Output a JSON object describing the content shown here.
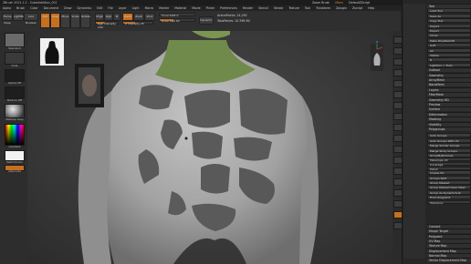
{
  "titlebar": {
    "title": "ZBrush 2021.1.2 - SubstAddition_001",
    "menu_label": "Menu",
    "default_zscript": "DefaultZScript",
    "left_hint": "Zoom Brush",
    "progress_label": "2"
  },
  "menubar": {
    "items": [
      "Alpha",
      "Brush",
      "Color",
      "Document",
      "Draw",
      "Dynamics",
      "Edit",
      "File",
      "Layer",
      "Light",
      "Macro",
      "Marker",
      "Material",
      "Movie",
      "Picker",
      "Preferences",
      "Render",
      "Stencil",
      "Stroke",
      "Texture",
      "Tool",
      "Transform",
      "Zplugin",
      "Zscript",
      "Help"
    ]
  },
  "toolbar": {
    "home_label": "Home Page",
    "lightbox_label": "LightBox",
    "live_boolean_label": "Live Boolean",
    "edit_label": "Edit",
    "draw_label": "Draw",
    "move_label": "Move",
    "scale_label": "Scale",
    "rotate_label": "Rotate",
    "mrgb_label": "Mrgb",
    "rgb_label": "Rgb",
    "m_label": "M",
    "zadd_label": "Zadd",
    "zsub_label": "Zsub",
    "zcut_label": "Zcut",
    "focal_shift_label": "Focal Shift 0",
    "draw_size_label": "Draw Size 64",
    "z_intensity_label": "Z Intensity 25",
    "rgb_intensity_label": "Rgb Intensity 100",
    "dynamic_label": "Dynamic",
    "active_points_label": "ActivePoints: 24,292",
    "total_points_label": "TotalPoints: 10.398 Mil"
  },
  "left_shelf": {
    "brush_label": "Standard",
    "stroke_label": "Dots",
    "alpha_label": "Alpha Off",
    "texture_label": "Texture Off",
    "material_label": "MatCap Gray",
    "gradient_label": "Gradient",
    "switch_color_label": "SwitchColor",
    "alternate_label": "Alternate"
  },
  "right_panel": {
    "items": [
      {
        "label": "Tool",
        "type": "hdr"
      },
      {
        "label": "Load Tool",
        "type": "btn"
      },
      {
        "label": "Save As",
        "type": "btn"
      },
      {
        "label": "Copy Tool",
        "type": "btn"
      },
      {
        "label": "Import",
        "type": "btn"
      },
      {
        "label": "Export",
        "type": "btn"
      },
      {
        "label": "Clone",
        "type": "btn"
      },
      {
        "label": "Make PolyMesh3D",
        "type": "btn"
      },
      {
        "label": "GoZ",
        "type": "btn"
      },
      {
        "label": "All",
        "type": "btn"
      },
      {
        "label": "Visible",
        "type": "btn"
      },
      {
        "label": "R",
        "type": "btn"
      },
      {
        "label": "Lightbox > Tools",
        "type": "btn"
      },
      {
        "label": "Subtool",
        "type": "hdr"
      },
      {
        "label": "Geometry",
        "type": "hdr"
      },
      {
        "label": "ArrayMesh",
        "type": "hdr"
      },
      {
        "label": "NanoMesh",
        "type": "hdr"
      },
      {
        "label": "Layers",
        "type": "hdr"
      },
      {
        "label": "FiberMesh",
        "type": "hdr"
      },
      {
        "label": "Geometry HD",
        "type": "hdr"
      },
      {
        "label": "Preview",
        "type": "hdr"
      },
      {
        "label": "Surface",
        "type": "hdr"
      },
      {
        "label": "Deformation",
        "type": "hdr"
      },
      {
        "label": "Masking",
        "type": "hdr"
      },
      {
        "label": "Visibility",
        "type": "hdr"
      },
      {
        "label": "Polygroups",
        "type": "hdr"
      }
    ],
    "auto_groups_label": "Auto Groups",
    "uv_groups_label": "UV Groups",
    "auto_groups_with_uv_label": "Auto Groups With UV",
    "merge_similar_label": "Merge Similar Groups",
    "merge_stray_label": "Merge Stray Groups",
    "group_by_normals_label": "GroupByNormals",
    "max_angle_label": "MaxAngle 20",
    "groups_by_normals_label": "Group As Dynamesh",
    "coverage_label": "Coverage",
    "polish_label": "Polish",
    "crease_pg_label": "Crease PG",
    "groups_split_label": "Groups Split",
    "group_masked_label": "Group Masked",
    "group_masked_clear_label": "Group Masked Clear Mask",
    "group_as_dyna_label": "Group As DynamicSub",
    "from_polypaint_label": "From Polypaint",
    "tolerance_label": "Tolerance",
    "contact_label": "Contact",
    "morph_target_label": "Morph Target",
    "polypaint_label": "Polypaint",
    "uv_map_label": "UV Map",
    "texture_map_label": "Texture Map",
    "displacement_map_label": "Displacement Map",
    "normal_map_label": "Normal Map",
    "vector_displacement_label": "Vector Displacement Map"
  },
  "colors": {
    "accent": "#e08a2a",
    "viewport_bg": "#3a3a3a",
    "panel_bg": "#262626",
    "mesh": "#a9a9a9",
    "polygroup": "#5a5a5a",
    "neck": "#6f8a4a"
  }
}
